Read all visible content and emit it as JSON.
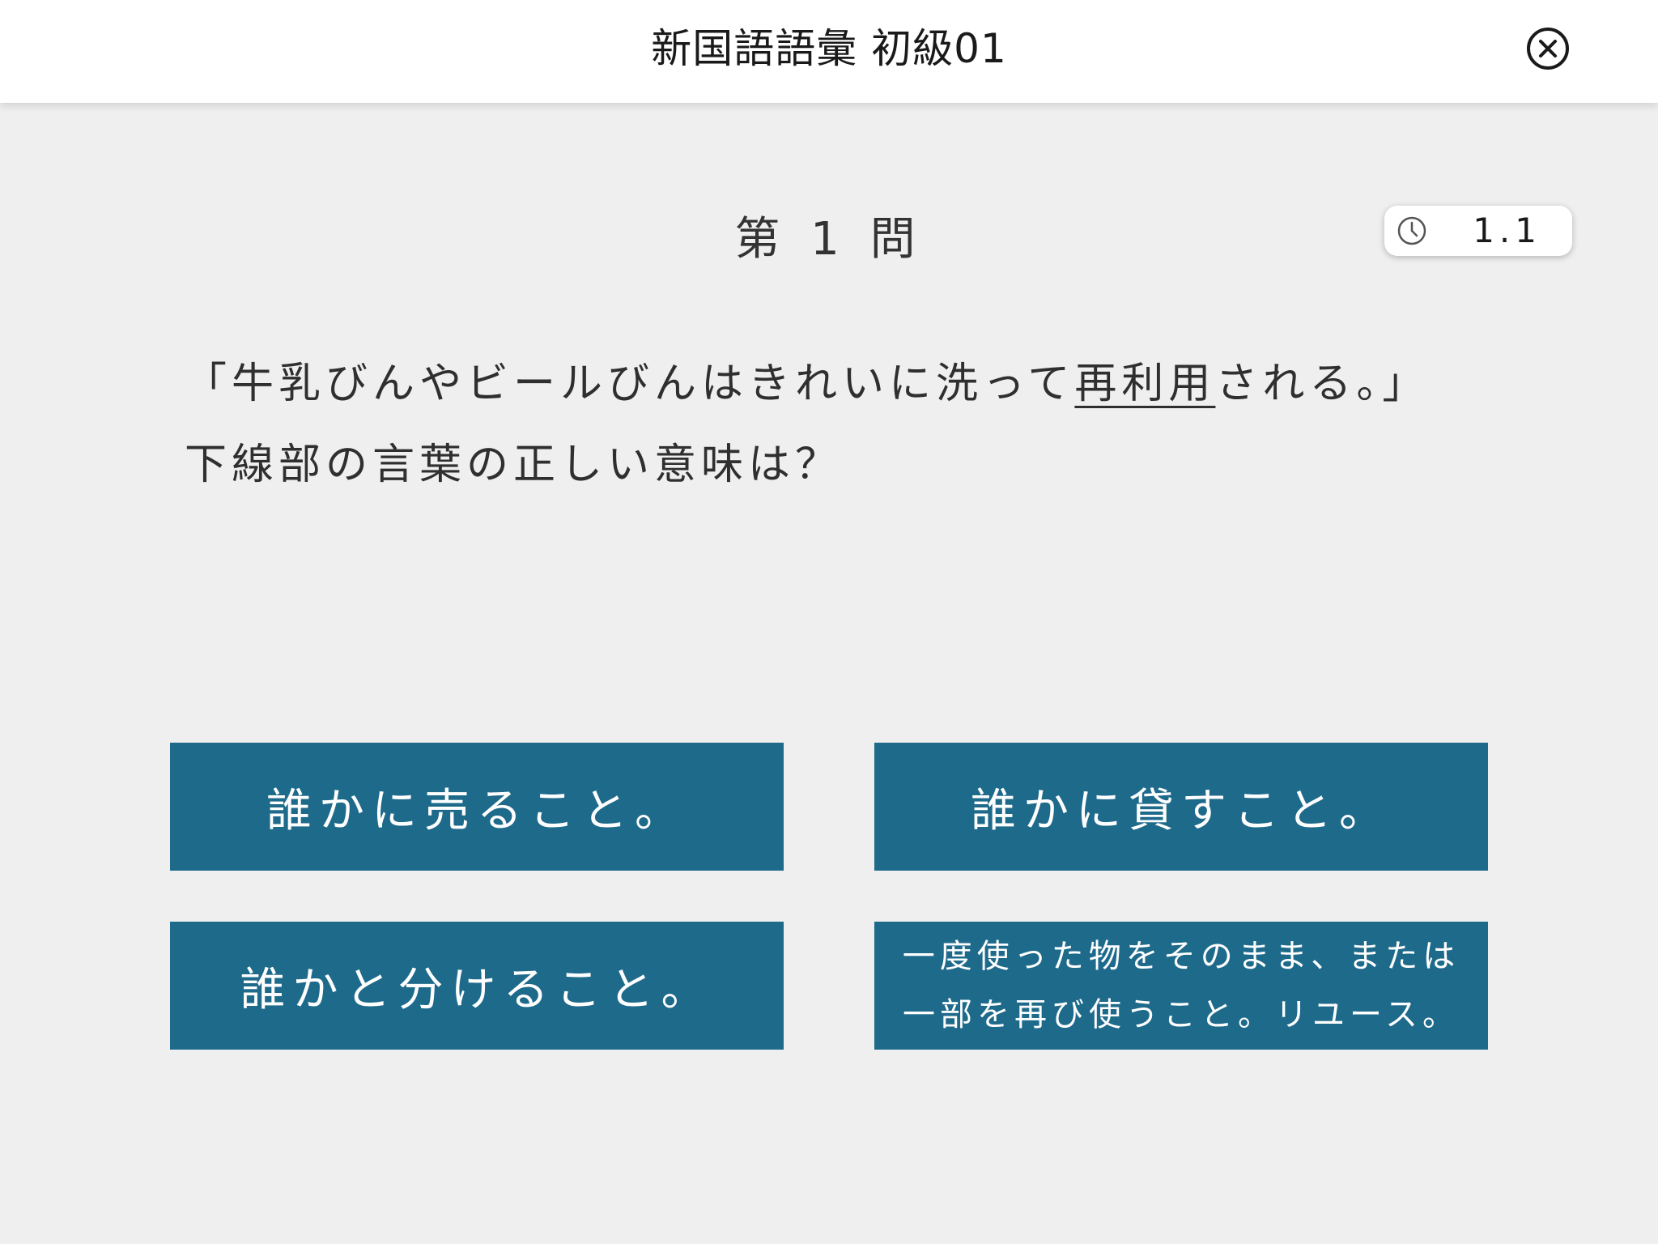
{
  "header": {
    "title": "新国語語彙 初級01",
    "close_icon": "close-circle-icon"
  },
  "question": {
    "number_label": "第 1 問",
    "timer": {
      "icon": "clock-icon",
      "value": "1.1"
    },
    "text_before": "「牛乳びんやビールびんはきれいに洗って",
    "text_underlined": "再利用",
    "text_after": "される。」",
    "prompt": "下線部の言葉の正しい意味は？"
  },
  "choices": [
    {
      "label": "誰かに売ること。"
    },
    {
      "label": "誰かに貸すこと。"
    },
    {
      "label": "誰かと分けること。"
    },
    {
      "label_line1": "一度使った物をそのまま、または",
      "label_line2": "一部を再び使うこと。リユース。"
    }
  ],
  "colors": {
    "choice_background": "#1e6a8b",
    "page_background": "#efefef",
    "header_background": "#ffffff"
  }
}
